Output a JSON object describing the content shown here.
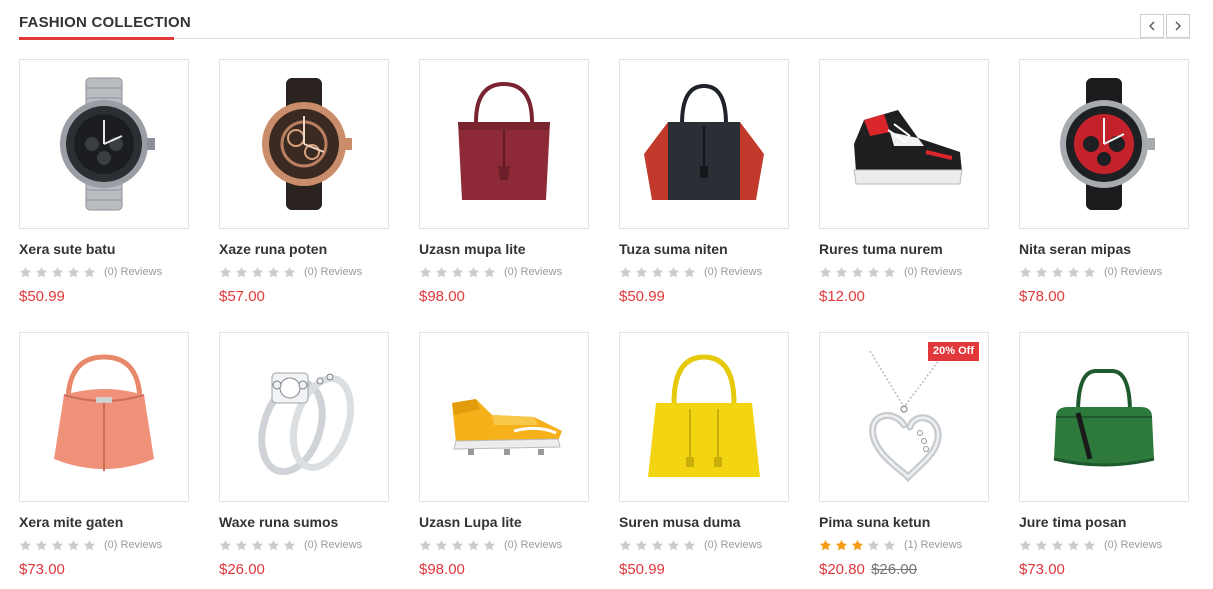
{
  "section": {
    "title": "FASHION COLLECTION"
  },
  "products": [
    {
      "name": "Xera sute batu",
      "reviews": "(0) Reviews",
      "rating": 0,
      "price": "$50.99",
      "icon": "wristwatch-steel-icon"
    },
    {
      "name": "Xaze runa poten",
      "reviews": "(0) Reviews",
      "rating": 0,
      "price": "$57.00",
      "icon": "wristwatch-skeleton-icon"
    },
    {
      "name": "Uzasn mupa lite",
      "reviews": "(0) Reviews",
      "rating": 0,
      "price": "$98.00",
      "icon": "handbag-burgundy-icon"
    },
    {
      "name": "Tuza suma niten",
      "reviews": "(0) Reviews",
      "rating": 0,
      "price": "$50.99",
      "icon": "handbag-tote-icon"
    },
    {
      "name": "Rures tuma nurem",
      "reviews": "(0) Reviews",
      "rating": 0,
      "price": "$12.00",
      "icon": "sneaker-icon"
    },
    {
      "name": "Nita seran mipas",
      "reviews": "(0) Reviews",
      "rating": 0,
      "price": "$78.00",
      "icon": "wristwatch-red-icon"
    },
    {
      "name": "Xera mite gaten",
      "reviews": "(0) Reviews",
      "rating": 0,
      "price": "$73.00",
      "icon": "bucket-bag-icon"
    },
    {
      "name": "Waxe runa sumos",
      "reviews": "(0) Reviews",
      "rating": 0,
      "price": "$26.00",
      "icon": "diamond-rings-icon"
    },
    {
      "name": "Uzasn Lupa lite",
      "reviews": "(0) Reviews",
      "rating": 0,
      "price": "$98.00",
      "icon": "football-boot-icon"
    },
    {
      "name": "Suren musa duma",
      "reviews": "(0) Reviews",
      "rating": 0,
      "price": "$50.99",
      "icon": "handbag-yellow-icon"
    },
    {
      "name": "Pima suna ketun",
      "reviews": "(1) Reviews",
      "rating": 3,
      "price": "$20.80",
      "old_price": "$26.00",
      "badge": "20% Off",
      "icon": "heart-pendant-icon"
    },
    {
      "name": "Jure tima posan",
      "reviews": "(0) Reviews",
      "rating": 0,
      "price": "$73.00",
      "icon": "duffel-bag-icon"
    }
  ],
  "colors": {
    "accent": "#e2383b",
    "star_on": "#f39c12",
    "star_off": "#cccccc"
  }
}
